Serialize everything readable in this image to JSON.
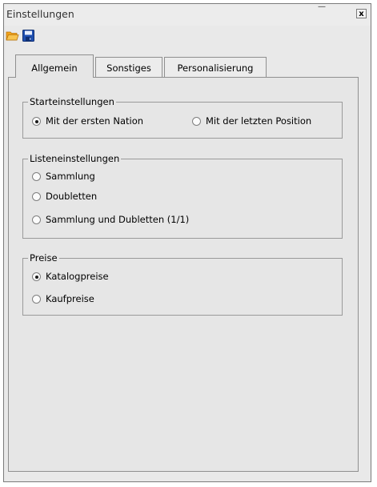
{
  "window": {
    "title": "Einstellungen",
    "close_symbol": "x",
    "min_symbol": "—"
  },
  "toolbar": {
    "open_icon": "folder-open-icon",
    "save_icon": "floppy-save-icon"
  },
  "tabs": [
    {
      "label": "Allgemein",
      "active": true
    },
    {
      "label": "Sonstiges",
      "active": false
    },
    {
      "label": "Personalisierung",
      "active": false
    }
  ],
  "groups": {
    "start": {
      "legend": "Starteinstellungen",
      "options": [
        {
          "label": "Mit der ersten Nation",
          "checked": true
        },
        {
          "label": "Mit der letzten Position",
          "checked": false
        }
      ]
    },
    "list": {
      "legend": "Listeneinstellungen",
      "options": [
        {
          "label": "Sammlung",
          "checked": false
        },
        {
          "label": "Doubletten",
          "checked": false
        },
        {
          "label": "Sammlung und Dubletten (1/1)",
          "checked": false
        }
      ]
    },
    "prices": {
      "legend": "Preise",
      "options": [
        {
          "label": "Katalogpreise",
          "checked": true
        },
        {
          "label": "Kaufpreise",
          "checked": false
        }
      ]
    }
  },
  "colors": {
    "folder": "#f2a31a",
    "floppy": "#1f4fb0"
  }
}
